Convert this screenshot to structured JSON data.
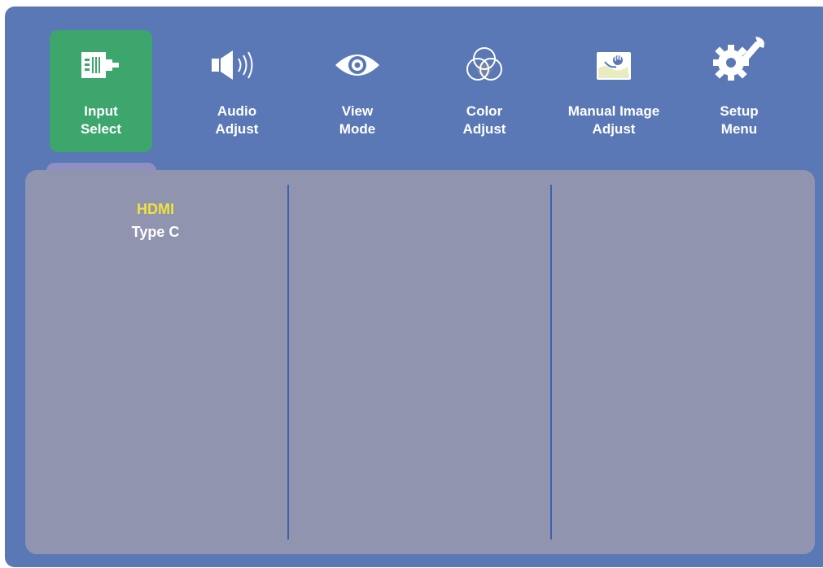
{
  "menu": {
    "tabs": [
      {
        "line1": "Input",
        "line2": "Select",
        "icon": "input-select-icon",
        "active": true
      },
      {
        "line1": "Audio",
        "line2": "Adjust",
        "icon": "speaker-icon",
        "active": false
      },
      {
        "line1": "View",
        "line2": "Mode",
        "icon": "eye-icon",
        "active": false
      },
      {
        "line1": "Color",
        "line2": "Adjust",
        "icon": "color-circles-icon",
        "active": false
      },
      {
        "line1": "Manual Image",
        "line2": "Adjust",
        "icon": "image-adjust-icon",
        "active": false
      },
      {
        "line1": "Setup",
        "line2": "Menu",
        "icon": "gear-wrench-icon",
        "active": false
      }
    ]
  },
  "input_select": {
    "options": [
      {
        "label": "HDMI",
        "selected": true
      },
      {
        "label": "Type C",
        "selected": false
      }
    ]
  },
  "colors": {
    "frame": "#5a78b6",
    "active_tab": "#3da66d",
    "panel": "#9094af",
    "divider": "#3b63ad",
    "selected_text": "#f0e33a",
    "text": "#ffffff"
  }
}
